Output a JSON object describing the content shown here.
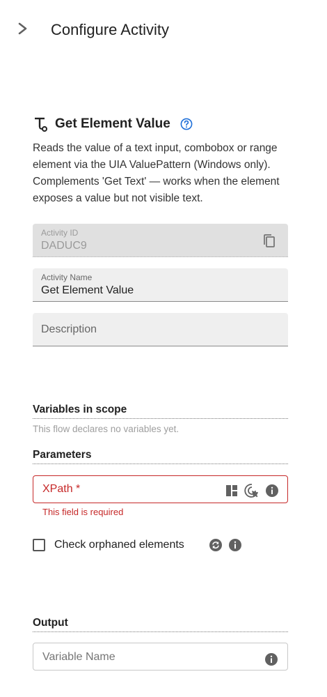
{
  "header": {
    "title": "Configure Activity",
    "collapse_icon": "chevron-right-icon"
  },
  "activity": {
    "title": "Get Element Value",
    "description": "Reads the value of a text input, combobox or range element via the UIA ValuePattern (Windows only). Complements 'Get Text' — works when the element exposes a value but not visible text."
  },
  "fields": {
    "activity_id": {
      "label": "Activity ID",
      "value": "DADUC9"
    },
    "activity_name": {
      "label": "Activity Name",
      "value": "Get Element Value"
    },
    "description": {
      "placeholder": "Description"
    }
  },
  "variables": {
    "heading": "Variables in scope",
    "empty_text": "This flow declares no variables yet."
  },
  "parameters": {
    "heading": "Parameters",
    "xpath": {
      "label": "XPath *",
      "error": "This field is required"
    },
    "check_orphaned": {
      "label": "Check orphaned elements",
      "checked": false
    }
  },
  "output": {
    "heading": "Output",
    "variable_placeholder": "Variable Name"
  },
  "colors": {
    "error": "#c62828",
    "accent": "#1e6fd9",
    "icon_gray": "#616161"
  }
}
